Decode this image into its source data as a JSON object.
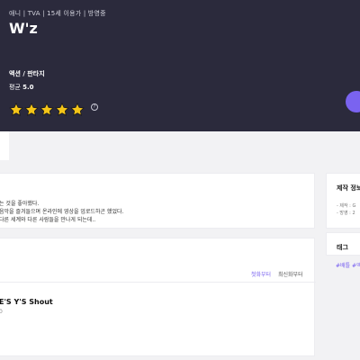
{
  "hero": {
    "meta": "애니 | TVA | 15세 이용가 | 방영중",
    "title": "W'z",
    "genre": "액션 / 판타지",
    "average_label": "평균",
    "average_value": "5.0",
    "rating_stars": 5,
    "rating_max": 5,
    "star_color": "#f5c518",
    "info_icon": "info-icon",
    "info_glyph": "?",
    "accent_color": "#7a63f0"
  },
  "description": {
    "lines": [
      "는 것을 좋아했다.",
      "음악을 즐겨들으며 온라인에 영상을 업로드하곤 했었다.",
      "다른 세계와 다른 사람들을 만나게 되는데.."
    ]
  },
  "episodes": {
    "sort_options": [
      {
        "label": "첫화부터",
        "active": true
      },
      {
        "label": "최신화부터",
        "active": false
      }
    ],
    "items": [
      {
        "title": "E'S Y'S Shout",
        "number": "0"
      }
    ]
  },
  "sidebar": {
    "production": {
      "title": "제작 정보",
      "rows": [
        "- 제작 : G",
        "- 방영 : 2"
      ]
    },
    "tags": {
      "title": "태그",
      "items": [
        "#배틀 #액"
      ]
    }
  }
}
